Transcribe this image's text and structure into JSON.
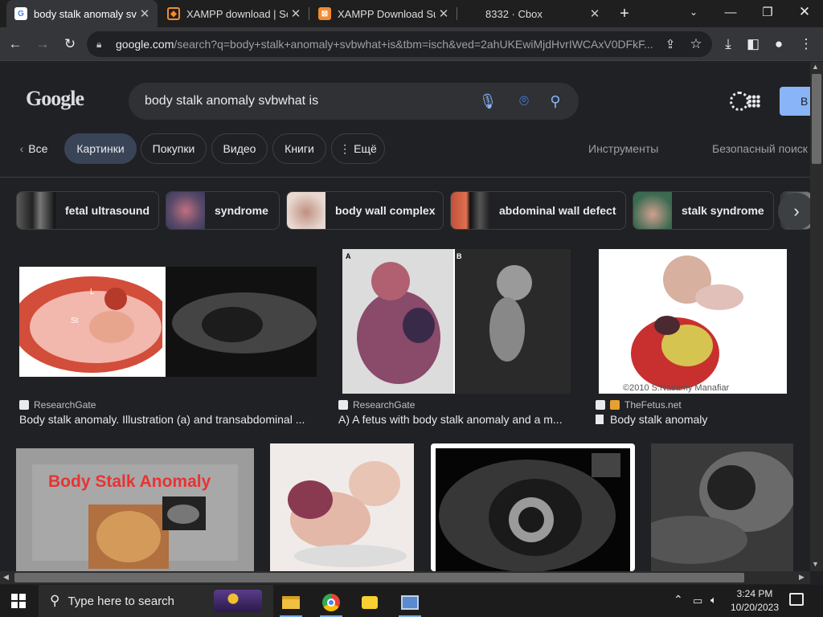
{
  "browser": {
    "tabs": [
      {
        "title": "body stalk anomaly svbw",
        "favicon": "google-icon"
      },
      {
        "title": "XAMPP download | Sou",
        "favicon": "xampp-icon"
      },
      {
        "title": "XAMPP Download Succ",
        "favicon": "xampp-icon"
      },
      {
        "title": "8332 · Cbox",
        "favicon": "none"
      }
    ],
    "url_host": "google.com",
    "url_path": "/search?q=body+stalk+anomaly+svbwhat+is&tbm=isch&ved=2ahUKEwiMjdHvrIWCAxV0DFkF..."
  },
  "google": {
    "logo_text": "Google",
    "query": "body stalk anomaly svbwhat is",
    "signin_label": "В",
    "filters": [
      {
        "label": "Все"
      },
      {
        "label": "Картинки"
      },
      {
        "label": "Покупки"
      },
      {
        "label": "Видео"
      },
      {
        "label": "Книги"
      },
      {
        "label": "Ещё"
      }
    ],
    "tools_label": "Инструменты",
    "safesearch_label": "Безопасный поиск",
    "chips": [
      {
        "label": "fetal ultrasound"
      },
      {
        "label": "syndrome"
      },
      {
        "label": "body wall complex"
      },
      {
        "label": "abdominal wall defect"
      },
      {
        "label": "stalk syndrome"
      }
    ],
    "results": [
      {
        "source": "ResearchGate",
        "caption": "Body stalk anomaly. Illustration (a) and transabdominal ..."
      },
      {
        "source": "ResearchGate",
        "caption": "A) A fetus with body stalk anomaly and a m..."
      },
      {
        "source": "TheFetus.net",
        "caption": "Body stalk anomaly"
      }
    ],
    "image_texts": {
      "r1_labels": [
        "St",
        "L"
      ],
      "r2_labels": [
        "A",
        "B"
      ],
      "r3_watermark": "©2010 S.Nasamy Manafiar",
      "r4_overlay": "Body Stalk Anomaly"
    }
  },
  "taskbar": {
    "search_placeholder": "Type here to search",
    "time": "3:24 PM",
    "date": "10/20/2023"
  },
  "colors": {
    "background": "#202124",
    "active_filter": "#394457",
    "signin_button": "#8ab4f8"
  }
}
